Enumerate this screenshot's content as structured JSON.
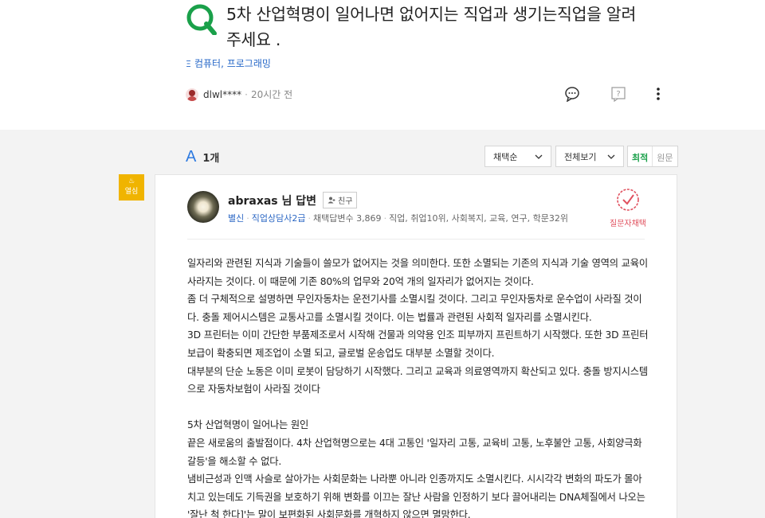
{
  "question": {
    "title_line1": "5차 산업혁명이 일어나면 없어지는 직업과 생기는직업을 알려",
    "title_line2": "주세요 .",
    "category": "컴퓨터, 프로그래밍",
    "author": "dlwl****",
    "time": "20시간 전",
    "icons": [
      "comment-icon",
      "report-icon",
      "more-icon"
    ]
  },
  "answers_header": {
    "label": "A",
    "count": "1개",
    "sort_select": "채택순",
    "view_select": "전체보기",
    "seg_best": "최적",
    "seg_original": "원문"
  },
  "answer": {
    "badge": "열심",
    "name": "abraxas 님 답변",
    "friend": "친구",
    "rank": "별신",
    "title": "직업상담사2급",
    "adopted": "채택답변수 3,869",
    "fields": "직업, 취업10위, 사회복지, 교육, 연구, 학문32위",
    "chosen_label": "질문자채택",
    "lines": [
      "일자리와 관련된 지식과 기술들이 쓸모가 없어지는 것을 의미한다. 또한 소멸되는 기존의 지식과 기술 영역의 교육이",
      "사라지는 것이다. 이 때문에 기존 80%의 업무와 20억 개의 일자리가 없어지는 것이다.",
      "좀 더 구체적으로 설명하면 무인자동차는 운전기사를 소멸시킬 것이다. 그리고 무인자동차로 운수업이 사라질 것이",
      "다. 충돌 제어시스템은 교통사고를 소멸시킬 것이다. 이는 법률과 관련된 사회적 일자리를 소멸시킨다.",
      "3D 프린터는 이미 간단한 부품제조로서 시작해 건물과 의약용 인조 피부까지 프린트하기 시작했다. 또한 3D 프린터",
      "보급이 확충되면 제조업이 소멸 되고, 글로벌 운송업도 대부분 소멸할 것이다.",
      "대부분의 단순 노동은 이미 로봇이 담당하기 시작했다. 그리고 교육과 의료영역까지 확산되고 있다. 충돌 방지시스템",
      "으로 자동차보험이 사라질 것이다",
      "",
      "5차 산업혁명이 일어나는 원인",
      "끝은 새로움의 출발점이다. 4차 산업혁명으로는 4대 고통인 '일자리 고통, 교육비 고통, 노후불안 고통, 사회양극화",
      "갈등'을 해소할 수 없다.",
      "냄비근성과 인맥 사슬로 살아가는 사회문화는 나라뿐 아니라 인종까지도 소멸시킨다. 시시각각 변화의 파도가 몰아",
      "치고 있는데도 기득권을 보호하기 위해 변화를 이끄는 잘난 사람을 인정하기 보다 끌어내리는 DNA체질에서 나오는",
      "'잘난 척 한다]'는 말이 보편화된 사회문화를 개혁하지 않으면 멸망한다."
    ]
  },
  "colors": {
    "accent_green": "#1aa04a",
    "link_blue": "#2768c8",
    "badge_yellow": "#f0b400",
    "chosen_red": "#e0505e"
  }
}
